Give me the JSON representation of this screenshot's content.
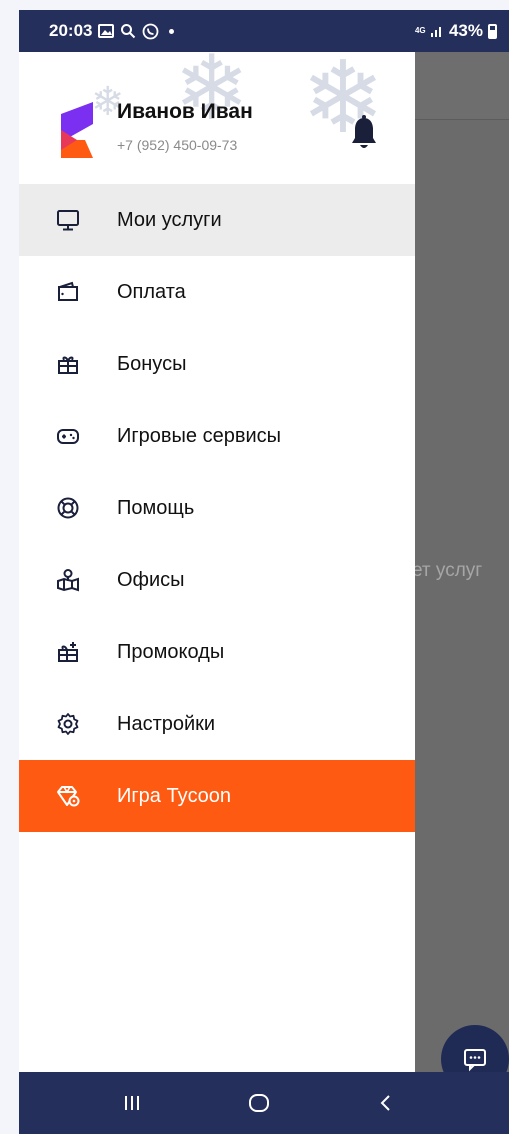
{
  "status_bar": {
    "time": "20:03",
    "network": "4G",
    "battery": "43%"
  },
  "user": {
    "name": "Иванов Иван",
    "phone": "+7 (952) 450-09-73"
  },
  "menu": [
    {
      "label": "Мои услуги",
      "icon": "monitor-icon",
      "active": true
    },
    {
      "label": "Оплата",
      "icon": "wallet-icon"
    },
    {
      "label": "Бонусы",
      "icon": "gift-icon"
    },
    {
      "label": "Игровые сервисы",
      "icon": "gamepad-icon"
    },
    {
      "label": "Помощь",
      "icon": "lifebuoy-icon"
    },
    {
      "label": "Офисы",
      "icon": "map-pin-icon"
    },
    {
      "label": "Промокоды",
      "icon": "promo-gift-icon"
    },
    {
      "label": "Настройки",
      "icon": "gear-icon"
    },
    {
      "label": "Игра Tycoon",
      "icon": "diamond-icon",
      "highlight": true
    }
  ],
  "background": {
    "partial_text": "ет услуг"
  },
  "colors": {
    "brand_orange": "#ff5a12",
    "brand_navy": "#252f5c",
    "brand_purple": "#7b2ff0"
  }
}
